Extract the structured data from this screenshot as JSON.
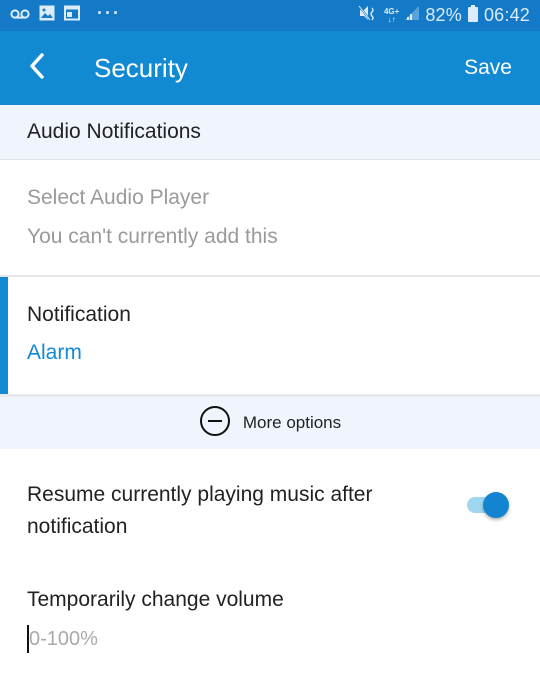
{
  "status_bar": {
    "left_icons": [
      "voicemail-icon",
      "image-icon",
      "calendar-icon",
      "more-dots-icon"
    ],
    "network": "4G+",
    "battery_percent": "82%",
    "time": "06:42",
    "right_icons": [
      "vibrate-mute-icon",
      "4g-icon",
      "signal-icon",
      "battery-icon"
    ]
  },
  "app_bar": {
    "back_icon": "chevron-left-icon",
    "title": "Security",
    "save_label": "Save",
    "color": "#1289d3"
  },
  "section": {
    "title": "Audio Notifications"
  },
  "audio_player": {
    "label": "Select Audio Player",
    "subtext": "You can't currently add this",
    "enabled": false
  },
  "notification": {
    "label": "Notification",
    "value": "Alarm",
    "accent_color": "#1289d3"
  },
  "more_options": {
    "icon": "minus-circle-icon",
    "label": "More options"
  },
  "resume_music": {
    "label": "Resume currently playing music after notification",
    "enabled": true
  },
  "volume": {
    "label": "Temporarily change volume",
    "value": "",
    "placeholder": "0-100%"
  }
}
